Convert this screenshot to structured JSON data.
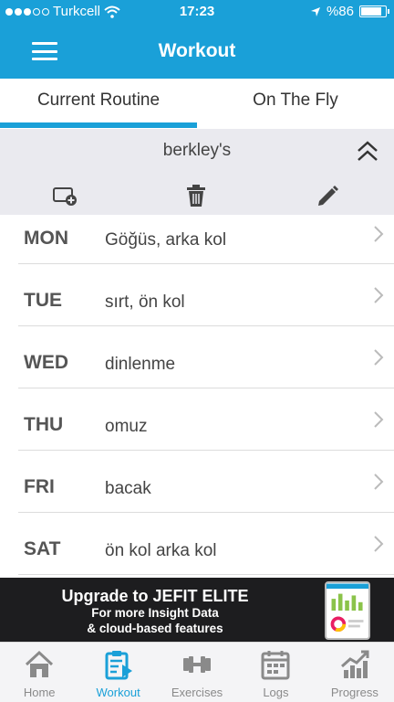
{
  "status_bar": {
    "carrier": "Turkcell",
    "time": "17:23",
    "battery": "%86",
    "battery_level": 0.86
  },
  "header": {
    "title": "Workout"
  },
  "tabs": [
    {
      "label": "Current Routine",
      "active": true
    },
    {
      "label": "On The Fly",
      "active": false
    }
  ],
  "routine": {
    "name": "berkley's"
  },
  "days": [
    {
      "code": "MON",
      "desc": "Göğüs, arka kol"
    },
    {
      "code": "TUE",
      "desc": "sırt, ön kol"
    },
    {
      "code": "WED",
      "desc": "dinlenme"
    },
    {
      "code": "THU",
      "desc": "omuz"
    },
    {
      "code": "FRI",
      "desc": "bacak"
    },
    {
      "code": "SAT",
      "desc": "ön kol arka kol"
    }
  ],
  "banner": {
    "title": "Upgrade to JEFIT ELITE",
    "line1": "For more Insight Data",
    "line2": "& cloud-based features"
  },
  "tabbar": [
    {
      "label": "Home",
      "icon": "home-icon"
    },
    {
      "label": "Workout",
      "icon": "workout-icon",
      "active": true
    },
    {
      "label": "Exercises",
      "icon": "dumbbell-icon"
    },
    {
      "label": "Logs",
      "icon": "calendar-icon"
    },
    {
      "label": "Progress",
      "icon": "chart-icon"
    }
  ],
  "colors": {
    "accent": "#1aa0d8",
    "icon_gray": "#8a8a8a",
    "banner_bg": "#1d1d1f"
  }
}
